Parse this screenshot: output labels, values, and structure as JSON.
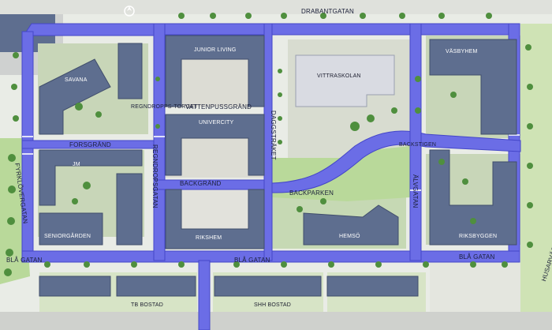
{
  "title": "",
  "colors": {
    "street": "#6b6de6",
    "street_edge": "#4446c8",
    "building": "#5e6e8f",
    "building_edge": "#404d6b",
    "park": "#b9d99a",
    "courtyard": "#a6c39a",
    "tree": "#4f8f3e",
    "ground": "#e9ece6",
    "plaza": "#dcdcd4"
  },
  "streets": {
    "drabantgatan": "DRABANTGATAN",
    "bla_gatan_left": "BLÅ GATAN",
    "bla_gatan_mid": "BLÅ GATAN",
    "bla_gatan_right": "BLÅ GATAN",
    "forsgrand": "FORSGRÄND",
    "backgrand": "BACKGRÄND",
    "regndroppsgatan": "REGNDROPSGATAN",
    "algatan": "ÄLVGATAN",
    "daggstraket": "DAGGSTRÄKET",
    "fyrklovergatan": "FYRKLÖVERGATAN",
    "husarvagen": "HUSARVÄGEN",
    "vattenpussgrand": "VATTENPUSSGRÄND",
    "regndroppstorget": "REGNDROPPS-TORGET",
    "backparken": "BACKPARKEN",
    "backstigen": "BACKSTIGEN"
  },
  "buildings": {
    "junior_living": "JUNIOR LIVING",
    "vittraskolan": "VITTRASKOLAN",
    "vasbyhem": "VÄSBYHEM",
    "savana": "SAVANA",
    "univercity": "UNIVERCITY",
    "jm": "JM",
    "seniorgarden": "SENIORGÅRDEN",
    "rikshem": "RIKSHEM",
    "hemso": "HEMSÖ",
    "riksbyggen": "RIKSBYGGEN",
    "tb_bostad": "TB BOSTAD",
    "shh_bostad": "SHH BOSTAD"
  },
  "legend": {
    "north_arrow": "north-arrow"
  }
}
